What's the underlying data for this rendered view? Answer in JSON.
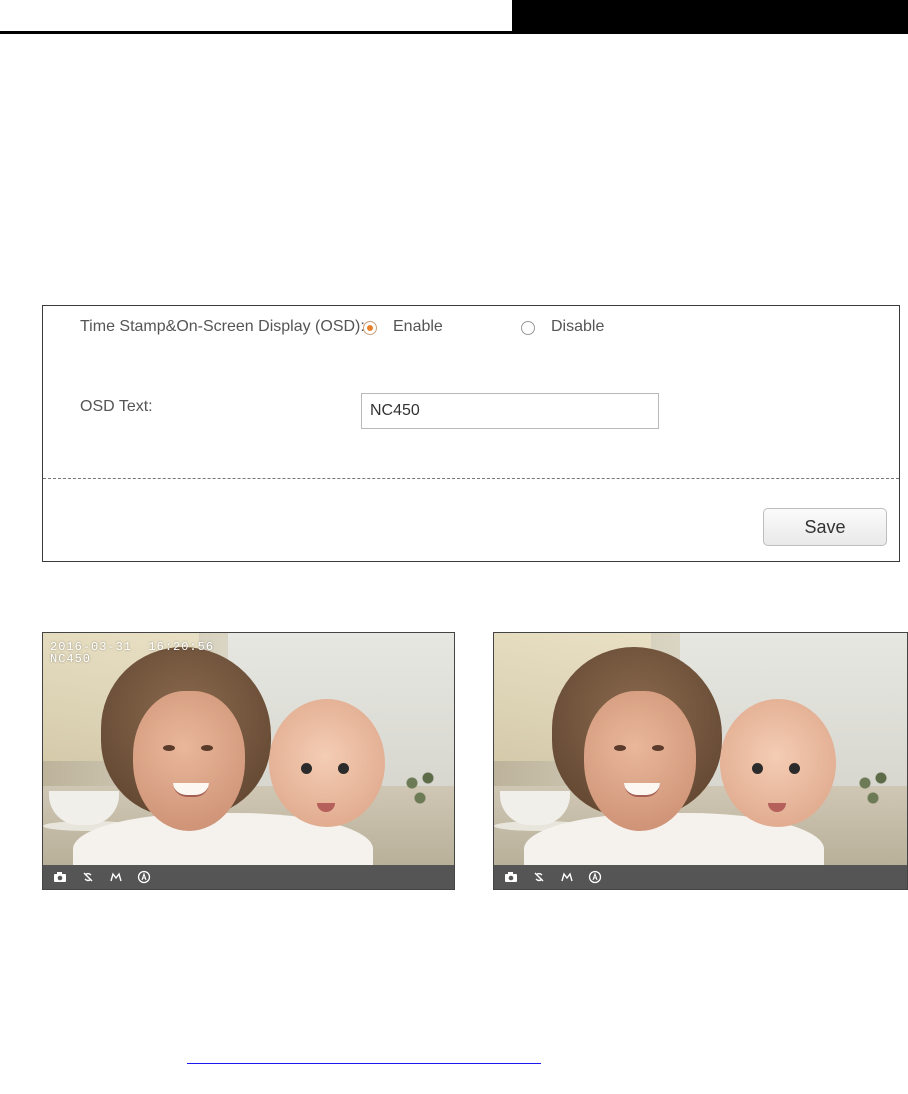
{
  "settings": {
    "osd_label": "Time Stamp&On-Screen Display (OSD):",
    "enable_label": "Enable",
    "disable_label": "Disable",
    "selected": "Enable",
    "osd_text_label": "OSD Text:",
    "osd_text_value": "NC450",
    "save_label": "Save"
  },
  "preview_left": {
    "timestamp": "2016-03-31  16:20:56",
    "osd_text": "NC450",
    "icons": [
      "camera-icon",
      "mic-off-icon",
      "patrol-icon",
      "auto-icon"
    ]
  },
  "preview_right": {
    "icons": [
      "camera-icon",
      "mic-off-icon",
      "patrol-icon",
      "auto-icon"
    ]
  },
  "colors": {
    "accent": "#e8812a",
    "toolbar": "#555556",
    "link": "#1a1aee"
  }
}
